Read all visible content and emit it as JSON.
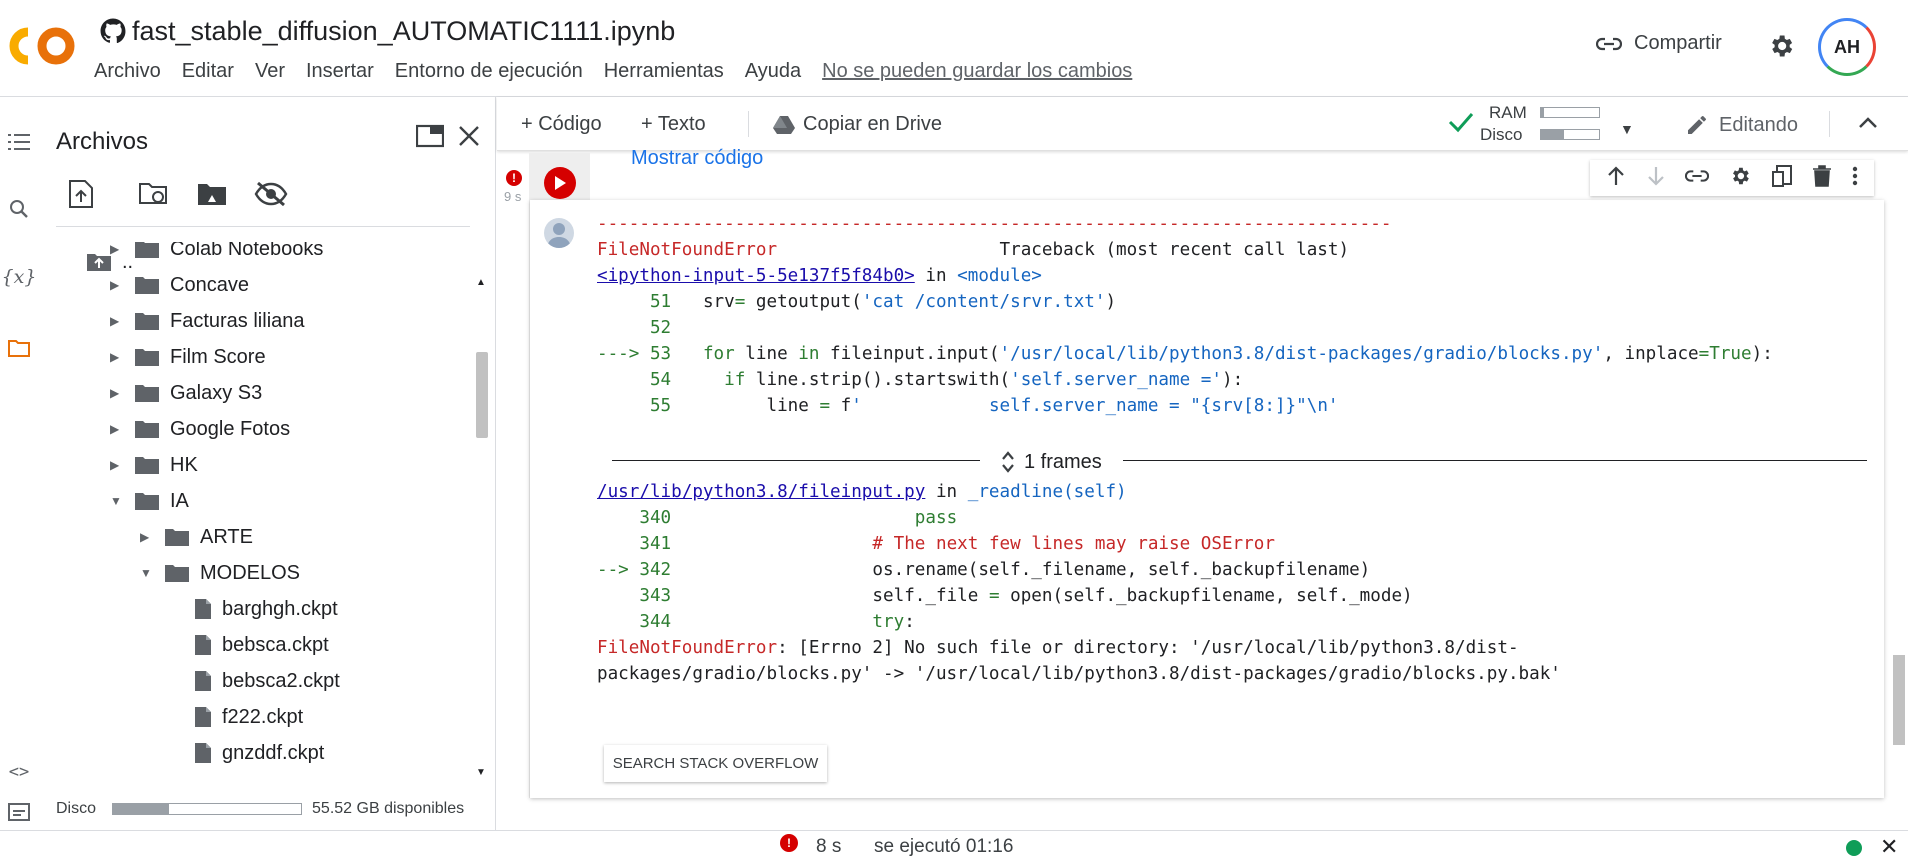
{
  "header": {
    "logo": "CO",
    "notebook_title": "fast_stable_diffusion_AUTOMATIC1111.ipynb",
    "menu": [
      "Archivo",
      "Editar",
      "Ver",
      "Insertar",
      "Entorno de ejecución",
      "Herramientas",
      "Ayuda"
    ],
    "save_warning": "No se pueden guardar los cambios",
    "share_label": "Compartir",
    "avatar_initials": "AH"
  },
  "files": {
    "title": "Archivos",
    "parent": "..",
    "tree": [
      {
        "name": "Colab Notebooks",
        "type": "folder",
        "expanded": false
      },
      {
        "name": "Concave",
        "type": "folder",
        "expanded": false
      },
      {
        "name": "Facturas liliana",
        "type": "folder",
        "expanded": false
      },
      {
        "name": "Film Score",
        "type": "folder",
        "expanded": false
      },
      {
        "name": "Galaxy S3",
        "type": "folder",
        "expanded": false
      },
      {
        "name": "Google Fotos",
        "type": "folder",
        "expanded": false
      },
      {
        "name": "HK",
        "type": "folder",
        "expanded": false
      },
      {
        "name": "IA",
        "type": "folder",
        "expanded": true
      },
      {
        "name": "ARTE",
        "type": "folder",
        "expanded": false
      },
      {
        "name": "MODELOS",
        "type": "folder",
        "expanded": true
      },
      {
        "name": "barghgh.ckpt",
        "type": "file"
      },
      {
        "name": "bebsca.ckpt",
        "type": "file"
      },
      {
        "name": "bebsca2.ckpt",
        "type": "file"
      },
      {
        "name": "f222.ckpt",
        "type": "file"
      },
      {
        "name": "gnzddf.ckpt",
        "type": "file"
      }
    ],
    "disk_label": "Disco",
    "disk_used_fraction": 0.3,
    "disk_free": "55.52 GB disponibles"
  },
  "toolbar": {
    "code_label": "+ Código",
    "text_label": "+ Texto",
    "copy_drive_label": "Copiar en Drive",
    "ram_label": "RAM",
    "disk_label": "Disco",
    "ram_fraction": 0.05,
    "disk_fraction": 0.4,
    "editing_label": "Editando"
  },
  "cell": {
    "show_code": "Mostrar código",
    "exec_time": "9 s",
    "dashes": "---------------------------------------------------------------------------",
    "error_name": "FileNotFoundError",
    "traceback_header": "Traceback (most recent call last)",
    "input_link": "<ipython-input-5-5e137f5f84b0>",
    "in_word": "in",
    "module": "<module>",
    "code_lines": [
      {
        "arrow": "",
        "num": "51",
        "code": "srv= getoutput('cat /content/srvr.txt')"
      },
      {
        "arrow": "",
        "num": "52",
        "code": ""
      },
      {
        "arrow": "---> ",
        "num": "53",
        "code": "for line in fileinput.input('/usr/local/lib/python3.8/dist-packages/gradio/blocks.py', inplace=True):"
      },
      {
        "arrow": "",
        "num": "54",
        "code": "  if line.strip().startswith('self.server_name ='):"
      },
      {
        "arrow": "",
        "num": "55",
        "code": "      line = f'            self.server_name = \"{srv[8:]}\"\\n'"
      }
    ],
    "frames_label": "1 frames",
    "file_link": "/usr/lib/python3.8/fileinput.py",
    "func": "_readline(self)",
    "frame_lines": [
      {
        "arrow": "",
        "num": "340",
        "code": "                    pass"
      },
      {
        "arrow": "",
        "num": "341",
        "code": "                # The next few lines may raise OSError"
      },
      {
        "arrow": "--> ",
        "num": "342",
        "code": "                os.rename(self._filename, self._backupfilename)"
      },
      {
        "arrow": "",
        "num": "343",
        "code": "                self._file = open(self._backupfilename, self._mode)"
      },
      {
        "arrow": "",
        "num": "344",
        "code": "                try:"
      }
    ],
    "final_error_name": "FileNotFoundError",
    "final_error_line1": ": [Errno 2] No such file or directory: '/usr/local/lib/python3.8/dist-",
    "final_error_line2": "packages/gradio/blocks.py' -> '/usr/local/lib/python3.8/dist-packages/gradio/blocks.py.bak'",
    "so_button": "SEARCH STACK OVERFLOW"
  },
  "status": {
    "time": "8 s",
    "executed": "se ejecutó 01:16"
  },
  "colors": {
    "error_red": "#d50000",
    "link_blue": "#1a73e8",
    "ok_green": "#0f9d58"
  }
}
